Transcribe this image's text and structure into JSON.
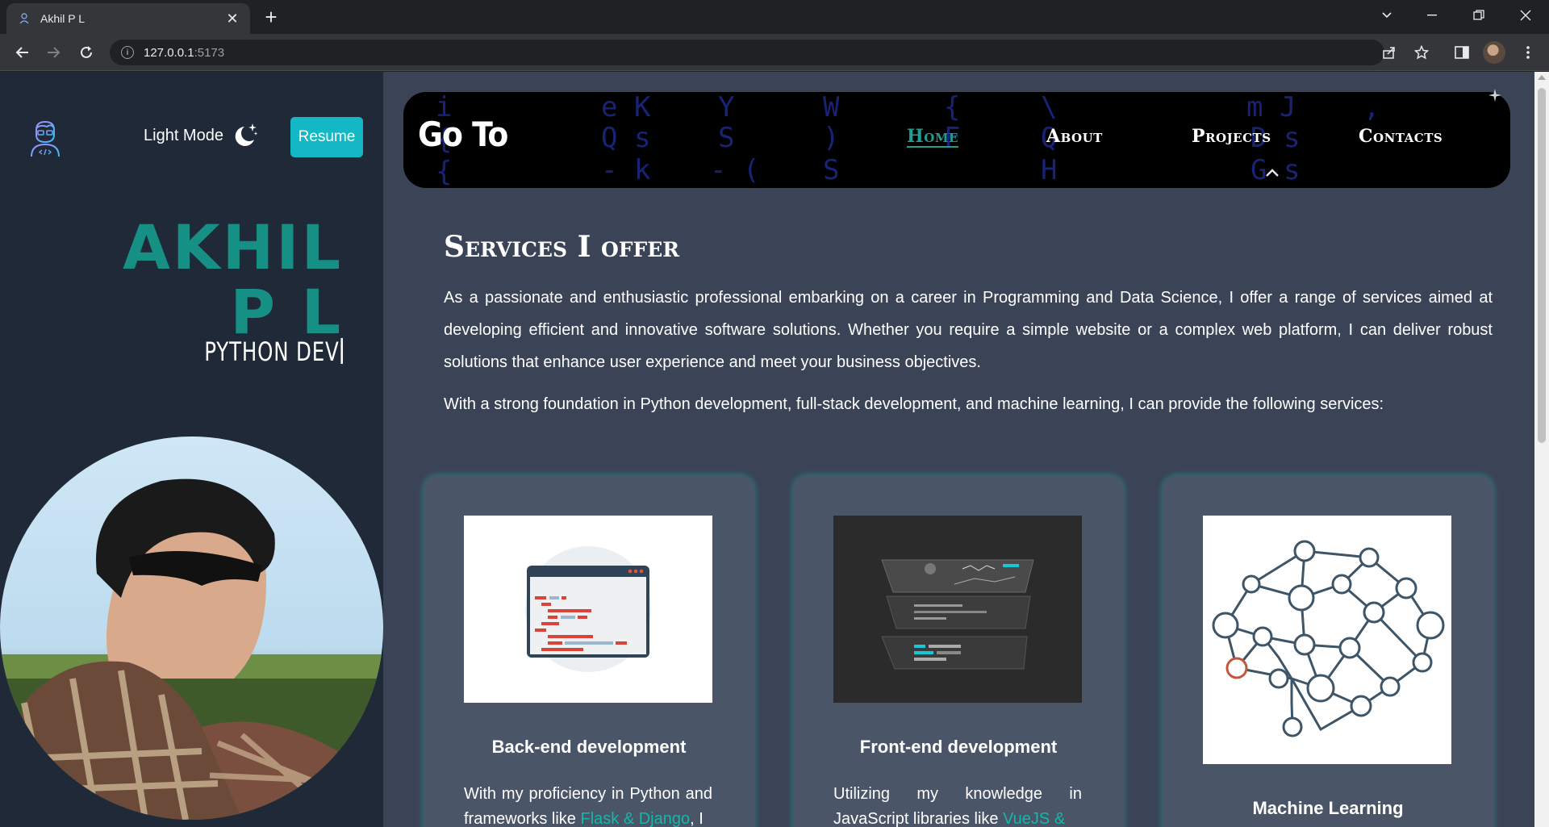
{
  "browser": {
    "tab_title": "Akhil P L",
    "tab_close": "✕",
    "new_tab": "+",
    "url_host": "127.0.0.1",
    "url_port": ":5173"
  },
  "sidebar": {
    "mode_label": "Light Mode",
    "resume_label": "Resume",
    "name_line1": "AKHIL",
    "name_line2": "P L",
    "role": "PYTHON DEV"
  },
  "nav": {
    "title": "Go To",
    "links": [
      "Home",
      "About",
      "Projects",
      "Contacts"
    ],
    "active": "Home"
  },
  "services": {
    "title": "Services I offer",
    "paragraph1": "As a passionate and enthusiastic professional embarking on a career in Programming and Data Science, I offer a range of services aimed at developing efficient and innovative software solutions. Whether you require a simple website or a complex web platform, I can deliver robust solutions that enhance user experience and meet your business objectives.",
    "paragraph2": "With a strong foundation in Python development, full-stack development, and machine learning, I can provide the following services:",
    "cards": [
      {
        "title": "Back-end development",
        "body_before": "With my proficiency in Python and frameworks like ",
        "body_highlight": "Flask & Django",
        "body_after": ", I"
      },
      {
        "title": "Front-end development",
        "body_before": "Utilizing my knowledge in JavaScript libraries like ",
        "body_highlight": "VueJS &",
        "body_after": ""
      },
      {
        "title": "Machine Learning",
        "body_before": "",
        "body_highlight": "",
        "body_after": ""
      }
    ]
  },
  "colors": {
    "accent_teal": "#168f85",
    "resume_bg": "#14b8c4",
    "sidebar_bg": "#1f2937",
    "page_bg": "#3b4457",
    "card_bg": "#4a5568"
  },
  "icons": [
    "coder-avatar-icon",
    "moon-stars-icon",
    "back-arrow-icon",
    "forward-arrow-icon",
    "reload-icon",
    "share-icon",
    "star-icon",
    "sidepanel-icon",
    "menu-dots-icon"
  ]
}
